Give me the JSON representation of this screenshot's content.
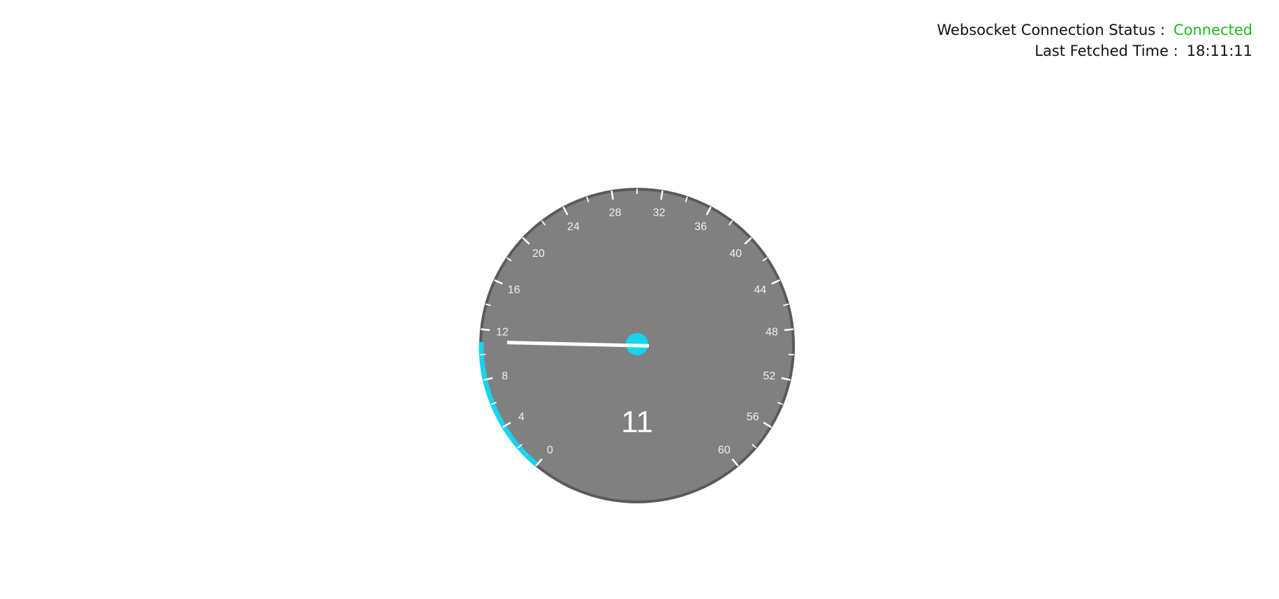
{
  "status": {
    "connection_label": "Websocket Connection Status :",
    "connection_value": "Connected",
    "connection_color": "#1db91d",
    "fetched_label": "Last Fetched Time :",
    "fetched_value": "18:11:11"
  },
  "gauge": {
    "value": 11,
    "value_label": "11",
    "min": 0,
    "max": 60,
    "major_ticks": [
      "0",
      "4",
      "8",
      "12",
      "16",
      "20",
      "24",
      "28",
      "32",
      "36",
      "40",
      "44",
      "48",
      "52",
      "56",
      "60"
    ],
    "minor_step": 2,
    "face_color": "#808080",
    "rim_color": "#5a5a5a",
    "progress_color": "#16d4f0",
    "needle_color": "#ffffff",
    "hub_color": "#16d4f0",
    "tick_color": "#ffffff"
  }
}
